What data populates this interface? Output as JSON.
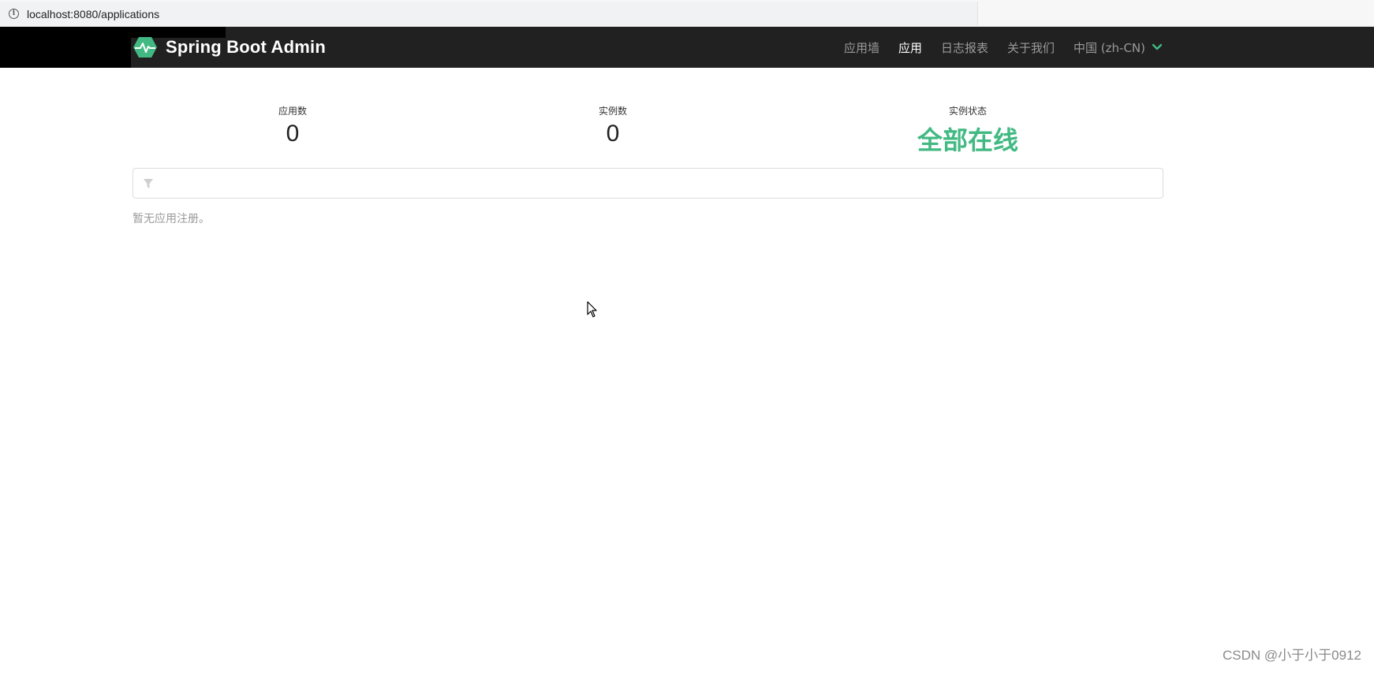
{
  "browser": {
    "url": "localhost:8080/applications"
  },
  "navbar": {
    "brand": "Spring Boot Admin",
    "items": [
      {
        "label": "应用墙",
        "active": false
      },
      {
        "label": "应用",
        "active": true
      },
      {
        "label": "日志报表",
        "active": false
      },
      {
        "label": "关于我们",
        "active": false
      }
    ],
    "language": "中国 (zh-CN)"
  },
  "stats": {
    "apps_label": "应用数",
    "apps_value": "0",
    "instances_label": "实例数",
    "instances_value": "0",
    "status_label": "实例状态",
    "status_value": "全部在线"
  },
  "filter": {
    "value": "",
    "placeholder": ""
  },
  "empty_message": "暂无应用注册。",
  "watermark": "CSDN @小于小于0912",
  "colors": {
    "navbar_bg": "#212121",
    "accent": "#42b983"
  }
}
